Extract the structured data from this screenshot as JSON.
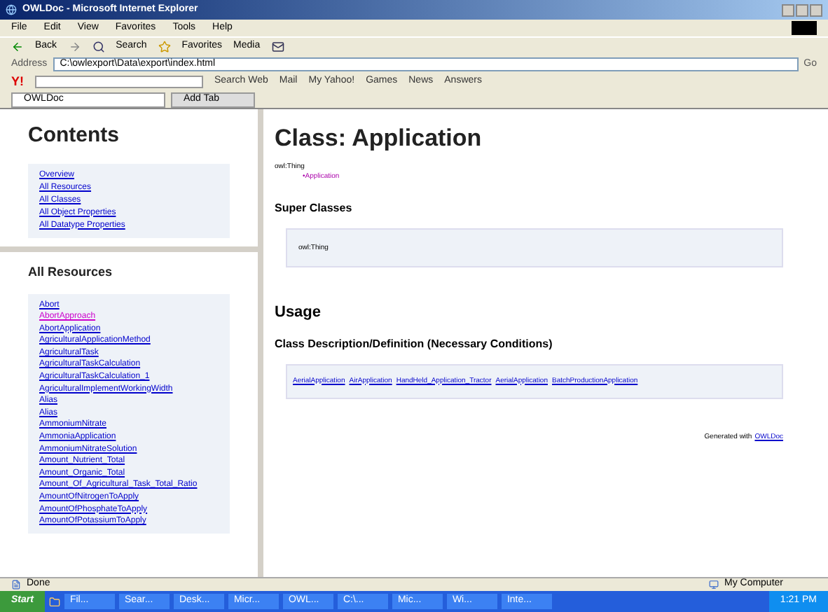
{
  "window": {
    "title": "OWLDoc - Microsoft Internet Explorer"
  },
  "menu": [
    "File",
    "Edit",
    "View",
    "Favorites",
    "Tools",
    "Help"
  ],
  "toolbar": [
    "Back",
    "Search",
    "Favorites",
    "Media"
  ],
  "address": {
    "label": "Address",
    "value": "C:\\owlexport\\Data\\export\\index.html",
    "go": "Go"
  },
  "yahoo_toolbar": {
    "logo": "Y!",
    "items": [
      "Search Web",
      "Mail",
      "My Yahoo!",
      "Games",
      "News",
      "Answers"
    ]
  },
  "tabs": [
    {
      "label": "OWLDoc",
      "selected": true
    },
    {
      "label": "Add Tab",
      "selected": false
    }
  ],
  "contents": {
    "title": "Contents",
    "links": [
      "Overview",
      "All Resources",
      "All Classes",
      "All Object Properties",
      "All Datatype Properties"
    ]
  },
  "resources": {
    "title": "All Resources",
    "links": [
      {
        "label": "Abort",
        "visited": false
      },
      {
        "label": "AbortApproach",
        "visited": true
      },
      {
        "label": "AbortApplication",
        "visited": false
      },
      {
        "label": "AgriculturalApplicationMethod",
        "visited": false
      },
      {
        "label": "AgriculturalTask",
        "visited": false
      },
      {
        "label": "AgriculturalTaskCalculation",
        "visited": false
      },
      {
        "label": "AgriculturalTaskCalculation_1",
        "visited": false
      },
      {
        "label": "AgriculturalImplementWorkingWidth",
        "visited": false
      },
      {
        "label": "Alias",
        "visited": false
      },
      {
        "label": "Alias",
        "visited": false
      },
      {
        "label": "AmmoniumNitrate",
        "visited": false
      },
      {
        "label": "AmmoniaApplication",
        "visited": false
      },
      {
        "label": "AmmoniumNitrateSolution",
        "visited": false
      },
      {
        "label": "Amount_Nutrient_Total",
        "visited": false
      },
      {
        "label": "Amount_Organic_Total",
        "visited": false
      },
      {
        "label": "Amount_Of_Agricultural_Task_Total_Ratio",
        "visited": false
      },
      {
        "label": "AmountOfNitrogenToApply",
        "visited": false
      },
      {
        "label": "AmountOfPhosphateToApply",
        "visited": false
      },
      {
        "label": "AmountOfPotassiumToApply",
        "visited": false
      }
    ]
  },
  "main": {
    "title": "Class: Application",
    "tree_root": "owl:Thing",
    "tree_child": "•Application",
    "super_title": "Super Classes",
    "super_classes": [
      "owl:Thing"
    ],
    "usage_title": "Usage",
    "definition_title": "Class Description/Definition (Necessary Conditions)",
    "definitions": [
      "AerialApplication",
      "AirApplication",
      "HandHeld_Application_Tractor",
      "AerialApplication",
      "BatchProductionApplication"
    ],
    "footer_text": "Generated with",
    "footer_link": "OWLDoc"
  },
  "status_bar": {
    "text": "Done",
    "zone": "My Computer"
  },
  "taskbar": {
    "start": "Start",
    "tasks": [
      "Fil...",
      "Sear...",
      "Desk...",
      "Micr...",
      "OWL...",
      "C:\\...",
      "Mic...",
      "Wi...",
      "Inte..."
    ],
    "clock": "1:21 PM"
  }
}
